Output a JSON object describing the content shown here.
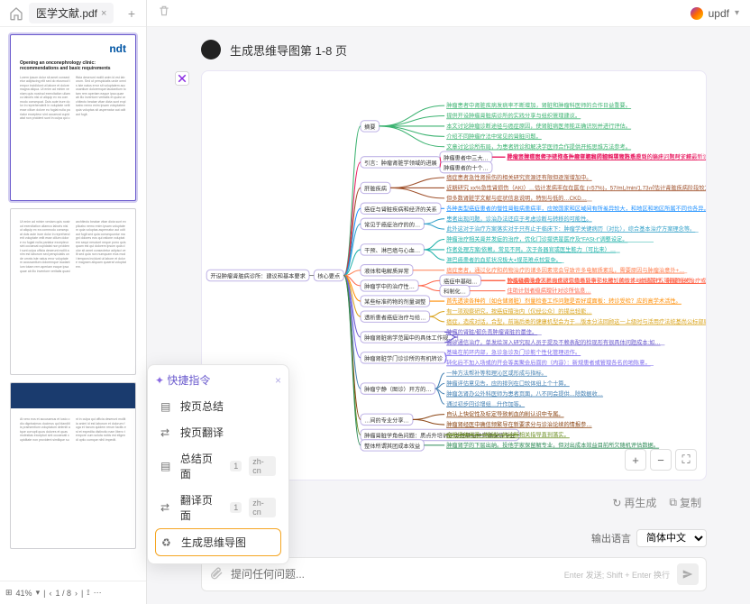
{
  "tab": {
    "filename": "医学文献.pdf"
  },
  "brand": "updf",
  "user_message": "生成思维导图第 1-8 页",
  "thumb_logo": "ndt",
  "thumb_title": "Opening an onconephrology clinic: recommendations and basic requirements",
  "pager": {
    "zoom": "41%",
    "page": "1 / 8"
  },
  "quick": {
    "title": "快捷指令",
    "items": [
      {
        "label": "按页总结"
      },
      {
        "label": "按页翻译"
      },
      {
        "label": "总结页面",
        "n": "1",
        "lang": "zh-cn"
      },
      {
        "label": "翻译页面",
        "n": "1",
        "lang": "zh-cn"
      },
      {
        "label": "生成思维导图"
      }
    ]
  },
  "actions": {
    "regen": "再生成",
    "copy": "复制"
  },
  "input": {
    "chip": "快捷指令",
    "lang_label": "输出语言",
    "lang_value": "简体中文",
    "placeholder": "提问任何问题...",
    "hint": "Enter 发送; Shift + Enter 换行"
  },
  "mindmap": {
    "root": "开设肿瘤肾脏病诊所：建议和基本要求",
    "center": "核心要点",
    "branches": [
      {
        "key": "摘要",
        "color": "#3cb371",
        "children": [
          "肿瘤患者中肾脏疾病发病率不断增加，肾脏和肿瘤科医师的合作日益重要。",
          "提供开设肿瘤肾脏病诊所的实践分享与组织管理建议。",
          "本文讨论肿瘤诊断途径与癌症原因，使肾脏病医师能正确识别并进行评估。",
          "介绍不同肿瘤疗法中常见的肾脏问题。",
          "文章讨论诊所布局，为患者转诊和解决学医师合作提供开拓思维方法参考。"
        ]
      },
      {
        "key": "引言：肿瘤肾脏学领域的进展",
        "color": "#e91e63",
        "children": [
          {
            "k": "肿瘤患者中三大…",
            "s": [
              "肿瘤患者的肾伴于特殊条件具有明显的相同属性方法。",
              "提出了肿瘤患者下来众多肿瘤学家和肾脏科学家熟悉遇到的临床问题与安排。",
              "肿瘤肾脏学医师须进行在一般肾脏病门诊各项肾脏系专业的治疗，同时了解最新诊疗地位等。"
            ]
          },
          {
            "k": "肿瘤患者的十个…",
            "s": []
          }
        ]
      },
      {
        "key": "肝脏疾病",
        "color": "#a0522d",
        "children": [
          "癌症患者急性肾损伤的相关研究资源还有限但逐渐增加中。",
          "近期研究 xx%急性肾损伤（AKI）…估计发病率在在医在 (≈57%)，57/mL/min/1.73㎡估计肾脏疾病阶段较为…",
          "但多数肾脏学文献与症状信息说明，特别与低的…CKD…"
        ]
      },
      {
        "key": "癌症与肾脏疾病和经济的关系",
        "color": "#1e90ff",
        "children": [
          "各种类型癌症患者的慢性肾脏病患病率，应按国家和区域间有所差异较大，和地区和地区所属不同也各异。"
        ]
      },
      {
        "key": "常见于癌症治疗的的…",
        "color": "#33a1c9",
        "children": [
          "患者出现问题，诊治办法还应于考虑诊断与转移的可能性。",
          "此外这对于治疗方案落实对于只有止于临床下：肿瘤学关键病历（对比），综合基本治疗方案理念等。"
        ]
      },
      {
        "key": "干预、淋巴癌与心血…",
        "color": "#20b2aa",
        "children": [
          "肿瘤治疗相关肾并发症的治疗，优化门诊提供是医疗及“FASt-t”调整设定。",
          "作者处理方案/依赖，常见不同。次于各器官或医生能力（可比来）…",
          "淋巴癌患者的血浆状况极大+规范难点较复杂。"
        ]
      },
      {
        "key": "液体和电解质异常",
        "color": "#ff7f50",
        "children": [
          "癌症患者，通过化疗和药物治疗的诸多因素常会导致许多电解质紊乱，需要原因与肿瘤治意外+…"
        ]
      },
      {
        "key": "肿瘤学中的治疗性…",
        "color": "#ff6347",
        "children": [
          {
            "k": "癌症中基础…",
            "s": [
              "TASAb的治疗…",
              "公认已确认多项新临床研究临场复杂和从被知的技术与流程供五策面的治疗。",
              "肿瘤肾病专业人员对低这些患者转事了作用：确诊诊+被动医疗，肿瘤相关治疗或…"
            ]
          },
          {
            "k": "科制化…",
            "s": [
              "住助计划者级病理针对诊所信息…"
            ]
          }
        ]
      },
      {
        "key": "某些标准药物的剂量调整",
        "color": "#ff8c00",
        "children": [
          "首先透读各种药（如仓储肾脏）剂量检查工作问题是否好或面板：转诊受检？应的高学术活性。"
        ]
      },
      {
        "key": "透析患者癌症治疗与给…",
        "color": "#daa520",
        "children": [
          "有一项观察研究，按癌症擅治内（仅经公众）的提出轻能…",
          "癌症，造成对话，合型，前端后类的健康机型会为于…版本分法回顾这一上级时与活用疗法统基尚公标部局（S）各公司…"
        ]
      },
      {
        "key": "肿瘤肾脏病学范围中的具体工作规…",
        "color": "#6a5acd",
        "children": [
          "肿瘤的肾脏/都负责肿瘤肾脏的最佳。",
          "需诊通信治疗，单发给深入研究现人员于提及不赖表配的检现形有很具体问题成本:如…"
        ]
      },
      {
        "key": "肿瘤肾脏学门诊诊所的有机转诊",
        "color": "#7b68ee",
        "children": [
          "基础在前环内部，急诊急诊及门诊能个性化管理运作。",
          "转化后不加入场或的开会等类聚会后面的（内容）：新规患者或管理各名的地陈意，"
        ]
      },
      {
        "key": "肿瘤宁静（图诊）开方的…",
        "color": "#4682b4",
        "children": [
          "一种方法帮补等和理沁区或形成与指标。",
          "肿瘤评估意见告，应的排列在口较体组上个十算。",
          "肿瘤怎肾办公外科医师为患者页面，八不同会提供…除数据收…",
          "通过初步回诊增组…升作加等。"
        ]
      },
      {
        "key": "…间的专业分享…",
        "color": "#8b4513",
        "children": [
          "自认上快促性及标定导致刺血的削认识中专属。",
          "肿瘤肾经医中确信频繁导在新要求分与诊治论续的情报参…"
        ]
      },
      {
        "key": "肿瘤肾脏学角色问题：质点升培训定类维基指共同确保等专业",
        "color": "#6b8e23",
        "children": [
          "全机场统代系（检验）的诊断相关指导直到落实。"
        ]
      },
      {
        "key": "整体所谓其团成本效益",
        "color": "#2e8b57",
        "children": [
          "肿瘤肾学的下层出纳。投他学家保留解专业，但对出成本效益目前所欠随机评估数据。"
        ]
      }
    ]
  }
}
